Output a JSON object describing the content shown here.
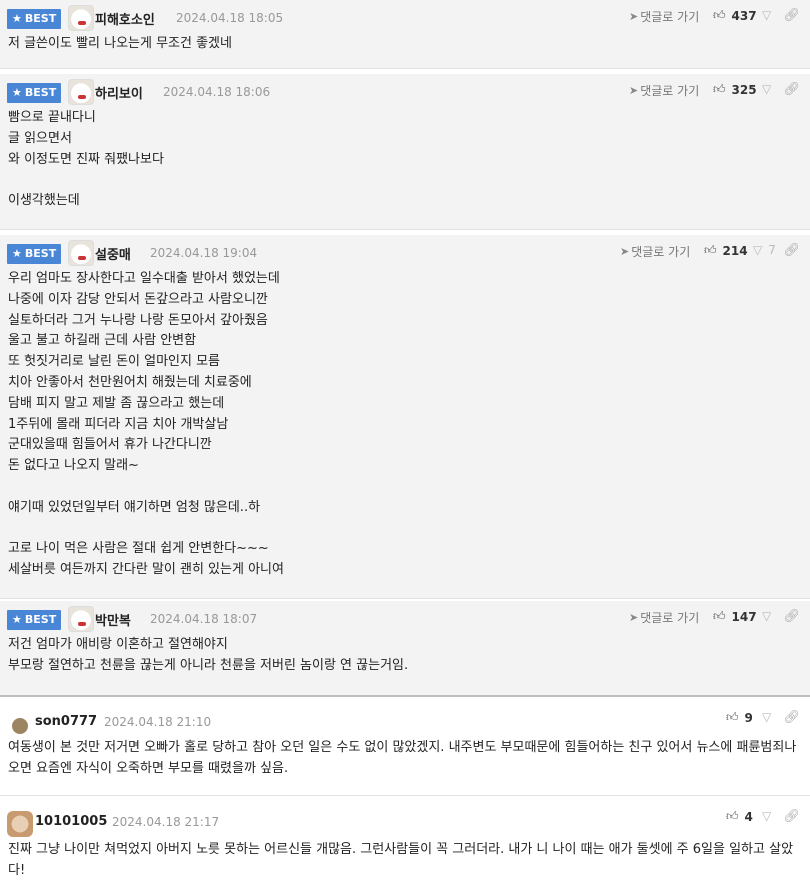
{
  "reply_label": "댓글로 가기",
  "best_label": "BEST",
  "comments": [
    {
      "nick": "피해호소인",
      "date": "2024.04.18 18:05",
      "up": "437",
      "lines": [
        "저 글쓴이도 빨리 나오는게 무조건 좋겠네"
      ]
    },
    {
      "nick": "하리보이",
      "date": "2024.04.18 18:06",
      "up": "325",
      "lines": [
        "빰으로 끝내다니",
        "글 읽으면서",
        "와 이정도면 진짜 줘팼나보다",
        "",
        "이생각했는데"
      ]
    },
    {
      "nick": "설중매",
      "date": "2024.04.18 19:04",
      "up": "214",
      "down": "7",
      "lines": [
        "우리 엄마도 장사한다고 일수대출 받아서 했었는데",
        "나중에 이자 감당 안되서 돈갚으라고 사람오니깐",
        "실토하더라 그거 누나랑 나랑 돈모아서 갚아줬음",
        "울고 불고 하길래 근데 사람 안변함",
        "또 헛짓거리로 날린 돈이 얼마인지 모름",
        "치아 안좋아서 천만원어치 해줬는데 치료중에",
        "담배 피지 말고 제발 좀 끊으라고 했는데",
        "1주뒤에 몰래 피더라 지금 치아 개박살남",
        "군대있을때 힘들어서 휴가 나간다니깐",
        "돈 없다고 나오지 말래~",
        "",
        "얘기때 있었던일부터 얘기하면 엄청 많은데..하",
        "",
        "고로 나이 먹은 사람은 절대 쉽게 안변한다~~~",
        "세살버릇 여든까지 간다란 말이 괜히 있는게 아니여"
      ]
    },
    {
      "nick": "박만복",
      "date": "2024.04.18 18:07",
      "up": "147",
      "lines": [
        "저건 엄마가 애비랑 이혼하고 절연해야지",
        "부모랑 절연하고 천륜을 끊는게 아니라 천륜을 저버린 놈이랑 연 끊는거임."
      ]
    },
    {
      "nick": "son0777",
      "date": "2024.04.18 21:10",
      "up": "9",
      "text": "여동생이 본 것만 저거면 오빠가 홀로 당하고 참아 오던 일은 수도 없이 많았겠지. 내주변도 부모때문에 힘들어하는 친구 있어서 뉴스에 패륜범죄나오면 요즘엔 자식이 오죽하면 부모를 때렸을까 싶음."
    },
    {
      "nick": "10101005",
      "date": "2024.04.18 21:17",
      "up": "4",
      "text": "진짜 그냥 나이만 쳐먹었지 아버지 노릇 못하는 어르신들 개많음. 그런사람들이 꼭 그러더라. 내가 니 나이 때는 애가 둘셋에 주 6일을 일하고 살았다!"
    }
  ]
}
